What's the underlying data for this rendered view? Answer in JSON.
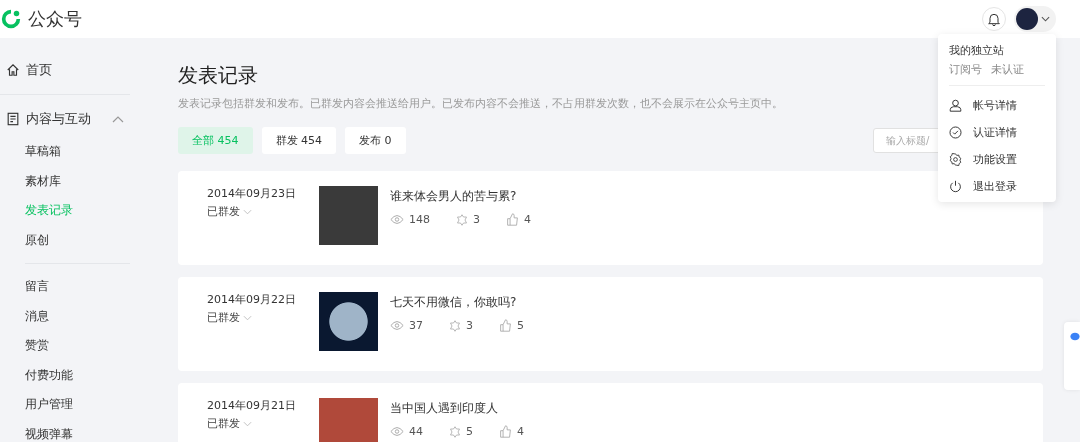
{
  "header": {
    "brand": "公众号"
  },
  "sidebar": {
    "items": [
      {
        "label": "首页",
        "kind": "top"
      },
      {
        "label": "内容与互动",
        "kind": "group",
        "expanded": true,
        "children": [
          {
            "label": "草稿箱",
            "selected": false
          },
          {
            "label": "素材库",
            "selected": false
          },
          {
            "label": "发表记录",
            "selected": true
          },
          {
            "label": "原创",
            "selected": false
          },
          {
            "label": "留言",
            "selected": false,
            "divider_before": true
          },
          {
            "label": "消息",
            "selected": false
          },
          {
            "label": "赞赏",
            "selected": false
          },
          {
            "label": "付费功能",
            "selected": false
          },
          {
            "label": "用户管理",
            "selected": false
          },
          {
            "label": "视频弹幕",
            "selected": false
          }
        ]
      }
    ]
  },
  "page": {
    "title": "发表记录",
    "description": "发表记录包括群发和发布。已群发内容会推送给用户。已发布内容不会推送，不占用群发次数，也不会展示在公众号主页中。",
    "tabs": [
      {
        "label": "全部 454",
        "selected": true
      },
      {
        "label": "群发 454",
        "selected": false
      },
      {
        "label": "发布 0",
        "selected": false
      }
    ],
    "search": {
      "placeholder": "输入标题/"
    }
  },
  "records": [
    {
      "date": "2014年09月23日",
      "status": "已群发",
      "title": "谁来体会男人的苦与累?",
      "views": "148",
      "shares": "3",
      "likes": "4"
    },
    {
      "date": "2014年09月22日",
      "status": "已群发",
      "title": "七天不用微信，你敢吗?",
      "views": "37",
      "shares": "3",
      "likes": "5"
    },
    {
      "date": "2014年09月21日",
      "status": "已群发",
      "title": "当中国人遇到印度人",
      "views": "44",
      "shares": "5",
      "likes": "4"
    }
  ],
  "account_menu": {
    "name": "我的独立站",
    "type": "订阅号",
    "verification": "未认证",
    "items": [
      {
        "label": "帐号详情"
      },
      {
        "label": "认证详情"
      },
      {
        "label": "功能设置"
      },
      {
        "label": "退出登录"
      }
    ]
  }
}
